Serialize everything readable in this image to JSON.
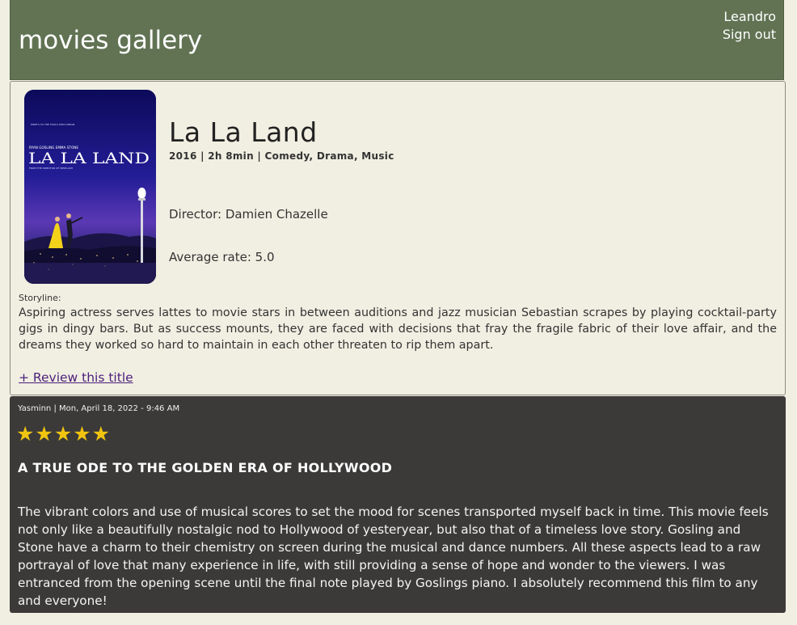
{
  "header": {
    "site_title": "movies gallery",
    "username": "Leandro",
    "signout_label": "Sign out"
  },
  "movie": {
    "title": "La La Land",
    "meta": "2016 | 2h 8min | Comedy, Drama, Music",
    "director": "Director: Damien Chazelle",
    "average_rate": "Average rate: 5.0",
    "storyline_label": "Storyline:",
    "storyline": "Aspiring actress serves lattes to movie stars in between auditions and jazz musician Sebastian scrapes by playing cocktail-party gigs in dingy bars. But as success mounts, they are faced with decisions that fray the fragile fabric of their love affair, and the dreams they worked so hard to maintain in each other threaten to rip them apart.",
    "review_link": "+ Review this title",
    "poster": {
      "actors": "RYAN GOSLING    EMMA STONE",
      "title_text": "LA LA LAND",
      "tagline": "FROM THE DIRECTOR OF WHIPLASH",
      "top_text": "HERE'S TO THE FOOLS WHO DREAM"
    }
  },
  "review": {
    "meta": "Yasminn | Mon, April 18, 2022 - 9:46 AM",
    "rating": 5,
    "stars": "★★★★★",
    "title": "A TRUE ODE TO THE GOLDEN ERA OF HOLLYWOOD",
    "body": "The vibrant colors and use of musical scores to set the mood for scenes transported myself back in time. This movie feels not only like a beautifully nostalgic nod to Hollywood of yesteryear, but also that of a timeless love story. Gosling and Stone have a charm to their chemistry on screen during the musical and dance numbers. All these aspects lead to a raw portrayal of love that many experience in life, with still providing a sense of hope and wonder to the viewers. I was entranced from the opening scene until the final note played by Goslings piano. I absolutely recommend this film to any and everyone!"
  },
  "colors": {
    "header_bg": "#617353",
    "page_bg": "#f1efe2",
    "review_bg": "#3b3a39",
    "star": "#f1c40f",
    "link": "#4b1f7a"
  }
}
